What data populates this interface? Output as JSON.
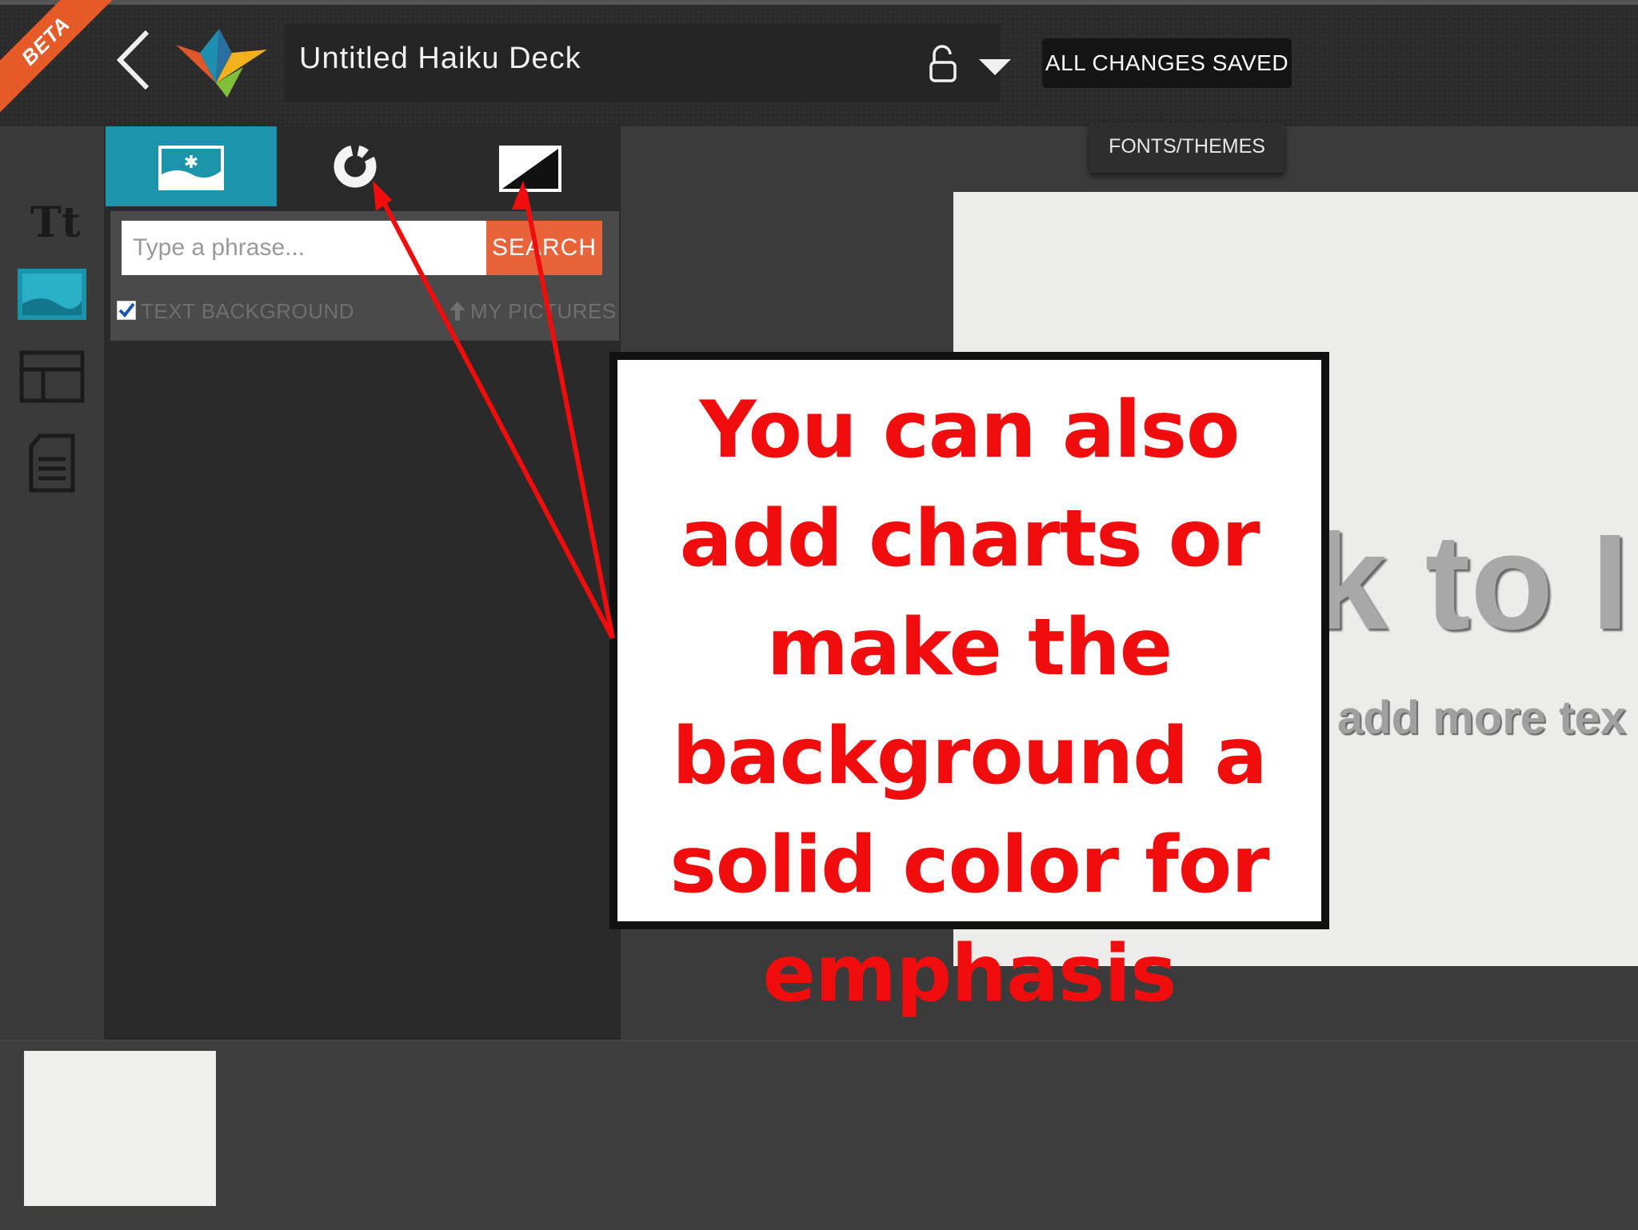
{
  "header": {
    "beta_badge": "BETA",
    "deck_title": "Untitled Haiku Deck",
    "save_status": "ALL CHANGES SAVED",
    "fonts_themes_label": "FONTS/THEMES"
  },
  "sidebar": {
    "text_tool_label": "Tt"
  },
  "panel": {
    "search": {
      "placeholder": "Type a phrase...",
      "button_label": "SEARCH"
    },
    "text_background_label": "TEXT BACKGROUND",
    "text_background_checked": true,
    "my_pictures_label": "MY PICTURES"
  },
  "slide": {
    "title_fragment": "k to I",
    "subtitle_fragment": "add more tex"
  },
  "callout": {
    "text": "You can also add charts or make the background a solid color for emphasis"
  },
  "colors": {
    "accent_teal": "#1c95ac",
    "search_orange": "#e8623a",
    "beta_orange": "#e65a28",
    "annotation_red": "#f10d0d"
  }
}
